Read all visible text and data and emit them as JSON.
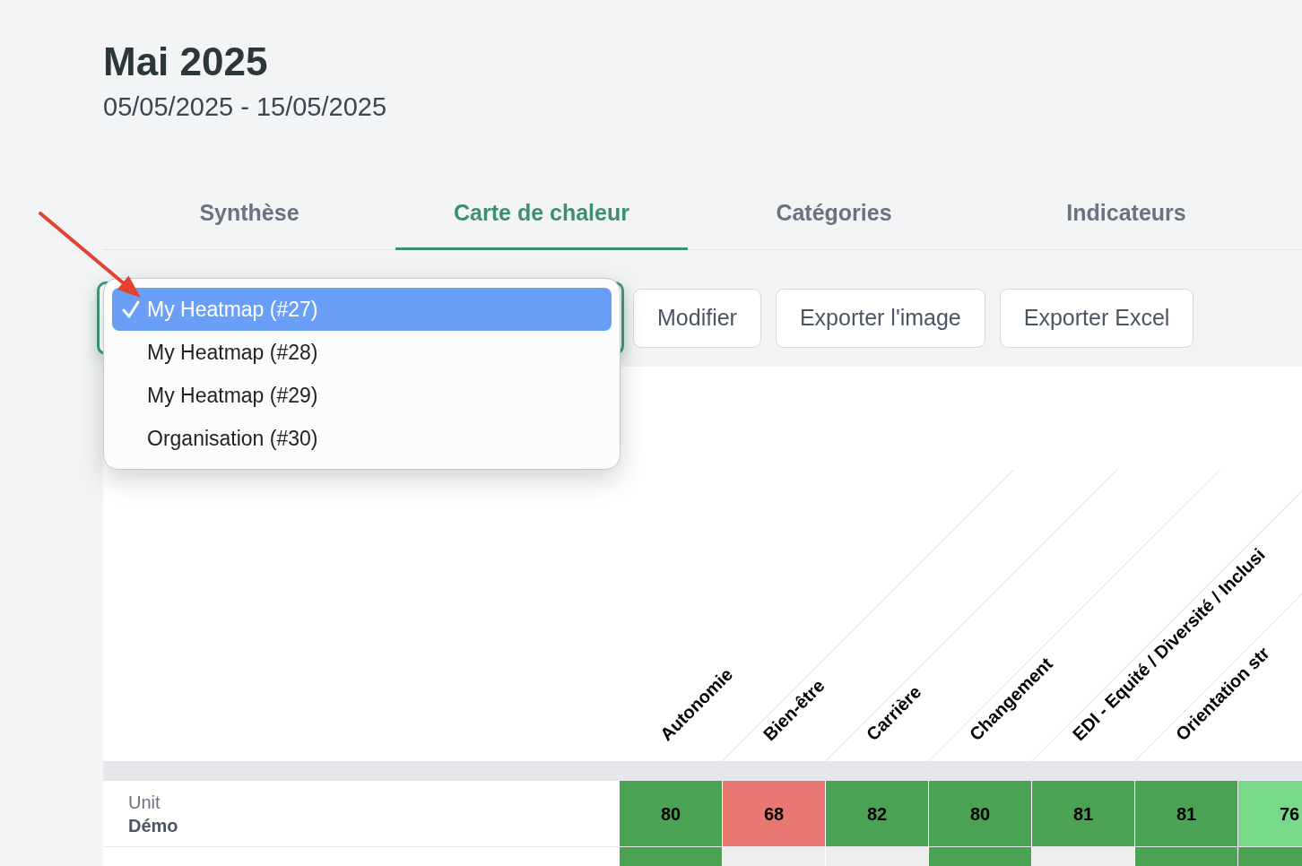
{
  "header": {
    "title": "Mai 2025",
    "date_range": "05/05/2025 - 15/05/2025"
  },
  "tabs": [
    {
      "label": "Synthèse",
      "selected": false
    },
    {
      "label": "Carte de chaleur",
      "selected": true
    },
    {
      "label": "Catégories",
      "selected": false
    },
    {
      "label": "Indicateurs",
      "selected": false
    }
  ],
  "toolbar": {
    "heatmap_select": {
      "expanded": true,
      "options": [
        {
          "label": "My Heatmap (#27)",
          "selected": true
        },
        {
          "label": "My Heatmap (#28)",
          "selected": false
        },
        {
          "label": "My Heatmap (#29)",
          "selected": false
        },
        {
          "label": "Organisation (#30)",
          "selected": false
        }
      ]
    },
    "buttons": [
      "Modifier",
      "Exporter l'image",
      "Exporter Excel"
    ]
  },
  "heatmap": {
    "columns": [
      "Autonomie",
      "Bien-être",
      "Carrière",
      "Changement",
      "EDI - Equité / Diversité / Inclusi",
      "Orientation str"
    ],
    "rows": [
      {
        "type_label": "Unit",
        "name": "Démo",
        "cells": [
          {
            "value": "80",
            "color": "#4ca254"
          },
          {
            "value": "68",
            "color": "#e97872"
          },
          {
            "value": "82",
            "color": "#4ca254"
          },
          {
            "value": "80",
            "color": "#4ca254"
          },
          {
            "value": "81",
            "color": "#4ca254"
          },
          {
            "value": "81",
            "color": "#4ca254"
          },
          {
            "value": "76",
            "color": "#78d98b"
          }
        ]
      },
      {
        "cells": [
          {
            "color": "#4ca254"
          },
          {
            "color": "#ededed"
          },
          {
            "color": "#ededed"
          },
          {
            "color": "#4ca254"
          },
          {
            "color": "#ededed"
          },
          {
            "color": "#4ca254"
          },
          {
            "color": "#4ca254"
          }
        ]
      }
    ]
  }
}
